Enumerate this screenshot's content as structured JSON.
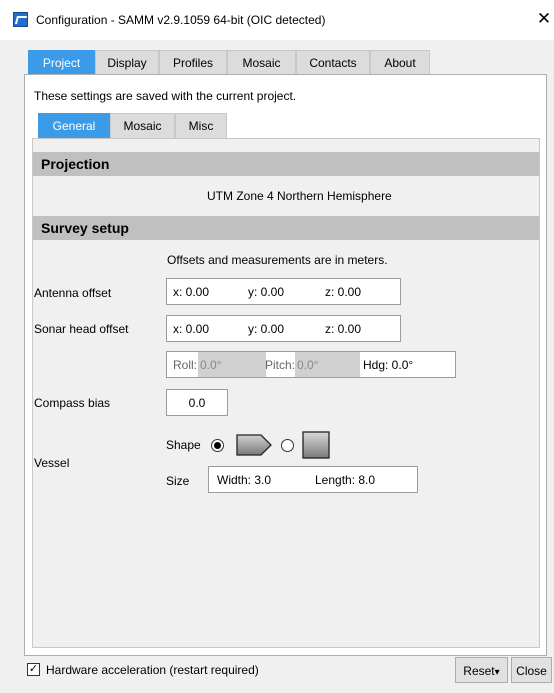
{
  "window": {
    "title": "Configuration - SAMM v2.9.1059 64-bit (OIC detected)",
    "close_glyph": "✕"
  },
  "tabs": [
    {
      "label": "Project"
    },
    {
      "label": "Display"
    },
    {
      "label": "Profiles"
    },
    {
      "label": "Mosaic"
    },
    {
      "label": "Contacts"
    },
    {
      "label": "About"
    }
  ],
  "note": "These settings are saved with the current project.",
  "subtabs": [
    {
      "label": "General"
    },
    {
      "label": "Mosaic"
    },
    {
      "label": "Misc"
    }
  ],
  "projection": {
    "header": "Projection",
    "value": "UTM Zone 4 Northern Hemisphere"
  },
  "survey": {
    "header": "Survey setup",
    "units_note": "Offsets and measurements are in meters.",
    "antenna": {
      "label": "Antenna offset",
      "x": "x: 0.00",
      "y": "y: 0.00",
      "z": "z: 0.00"
    },
    "sonar": {
      "label": "Sonar head offset",
      "x": "x: 0.00",
      "y": "y: 0.00",
      "z": "z: 0.00"
    },
    "attitude": {
      "roll_label": "Roll:",
      "roll": "0.0°",
      "pitch_label": "Pitch:",
      "pitch": "0.0°",
      "hdg": "Hdg: 0.0°"
    },
    "compass": {
      "label": "Compass bias",
      "value": "0.0"
    },
    "vessel": {
      "label": "Vessel",
      "shape_label": "Shape",
      "size_label": "Size",
      "width": "Width: 3.0",
      "length": "Length: 8.0",
      "shape_selected": "arrow"
    }
  },
  "footer": {
    "hw_accel_label": "Hardware acceleration (restart required)",
    "hw_accel_checked": "✓",
    "reset_label": "Reset",
    "reset_arrow": "▾",
    "close_label": "Close"
  }
}
